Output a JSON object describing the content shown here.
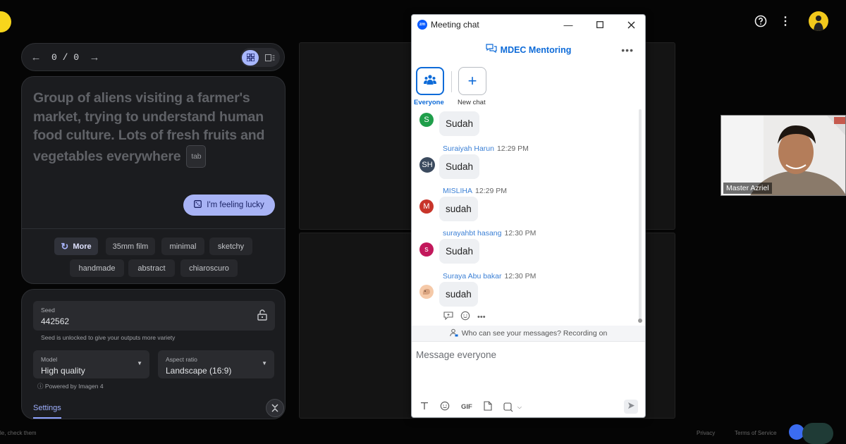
{
  "generator": {
    "nav": {
      "prev_icon": "arrow-left-icon",
      "counter": "0 / 0",
      "next_icon": "arrow-right-icon"
    },
    "prompt": {
      "text": "Group of aliens visiting a farmer's market, trying to understand human food culture. Lots of fresh fruits and vegetables everywhere",
      "tab_hint": "tab",
      "lucky_label": "I'm feeling lucky"
    },
    "styles": {
      "more_label": "More",
      "chips": [
        "35mm film",
        "minimal",
        "sketchy",
        "handmade",
        "abstract",
        "chiaroscuro"
      ]
    },
    "settings": {
      "seed_label": "Seed",
      "seed_value": "442562",
      "seed_hint": "Seed is unlocked to give your outputs more variety",
      "model_label": "Model",
      "model_value": "High quality",
      "aspect_label": "Aspect ratio",
      "aspect_value": "Landscape (16:9)",
      "powered_by": "Powered by Imagen 4",
      "settings_tab": "Settings"
    },
    "footer": {
      "left_text": "le, check them",
      "privacy": "Privacy",
      "terms": "Terms of Service"
    }
  },
  "video": {
    "participant_name": "Master Azriel"
  },
  "chat": {
    "window_title": "Meeting chat",
    "logo_text": "zm",
    "meeting_name": "MDEC Mentoring",
    "tabs": {
      "everyone": "Everyone",
      "new_chat": "New chat"
    },
    "messages": [
      {
        "initials": "S",
        "color": "#1f9e4a",
        "sender": "",
        "time": "",
        "text": "Sudah"
      },
      {
        "initials": "SH",
        "color": "#3b4a5e",
        "sender": "Suraiyah Harun",
        "time": "12:29 PM",
        "text": "Sudah"
      },
      {
        "initials": "M",
        "color": "#c8352a",
        "sender": "MISLIHA",
        "time": "12:29 PM",
        "text": "sudah"
      },
      {
        "initials": "s",
        "color": "#c2185b",
        "sender": "surayahbt hasang",
        "time": "12:30 PM",
        "text": "Sudah"
      },
      {
        "initials": "",
        "color": "#f5c9a8",
        "sender": "Suraya Abu bakar",
        "time": "12:30 PM",
        "text": "sudah"
      }
    ],
    "visibility_note": "Who can see your messages? Recording on",
    "compose_placeholder": "Message everyone",
    "toolbar_gif": "GIF"
  }
}
